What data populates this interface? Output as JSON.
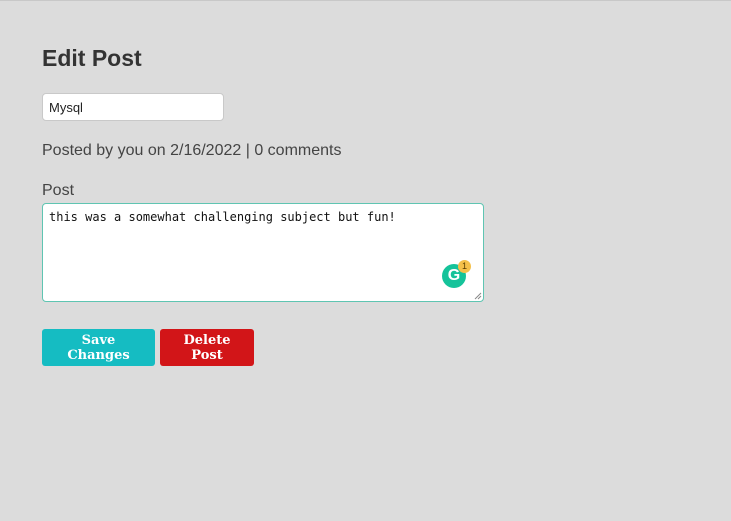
{
  "page": {
    "title": "Edit Post"
  },
  "form": {
    "title_value": "Mysql",
    "meta": {
      "prefix": "Posted by you on ",
      "date": "2/16/2022",
      "separator": " | ",
      "comments": "0 comments"
    },
    "post_label": "Post",
    "post_body": "this was a somewhat challenging subject but fun!",
    "grammarly": {
      "icon": "grammarly-icon",
      "letter": "G",
      "badge_count": "1"
    }
  },
  "actions": {
    "save_label": "Save Changes",
    "delete_label": "Delete Post",
    "save_color": "#15bcc2",
    "delete_color": "#d21518"
  }
}
